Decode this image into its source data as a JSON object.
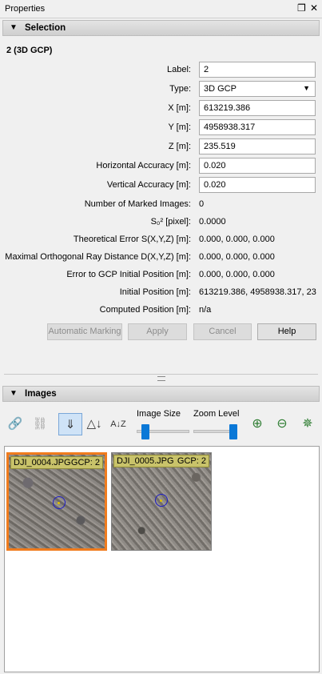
{
  "window": {
    "title": "Properties"
  },
  "selection": {
    "header": "Selection",
    "object_title": "2 (3D GCP)",
    "fields": {
      "label": {
        "label": "Label:",
        "value": "2"
      },
      "type": {
        "label": "Type:",
        "value": "3D GCP"
      },
      "x": {
        "label": "X [m]:",
        "value": "613219.386"
      },
      "y": {
        "label": "Y [m]:",
        "value": "4958938.317"
      },
      "z": {
        "label": "Z [m]:",
        "value": "235.519"
      },
      "h_acc": {
        "label": "Horizontal Accuracy [m]:",
        "value": "0.020"
      },
      "v_acc": {
        "label": "Vertical Accuracy [m]:",
        "value": "0.020"
      }
    },
    "readouts": {
      "marked": {
        "label": "Number of Marked Images:",
        "value": "0"
      },
      "s0": {
        "label": "S₀² [pixel]:",
        "value": "0.0000"
      },
      "theo": {
        "label": "Theoretical Error S(X,Y,Z) [m]:",
        "value": "0.000, 0.000, 0.000"
      },
      "maxray": {
        "label": "Maximal Orthogonal Ray Distance D(X,Y,Z) [m]:",
        "value": "0.000, 0.000, 0.000"
      },
      "err_init": {
        "label": "Error to GCP Initial Position [m]:",
        "value": "0.000, 0.000, 0.000"
      },
      "init_pos": {
        "label": "Initial Position [m]:",
        "value": "613219.386, 4958938.317, 23"
      },
      "comp_pos": {
        "label": "Computed Position [m]:",
        "value": "n/a"
      }
    },
    "buttons": {
      "auto": "Automatic Marking",
      "apply": "Apply",
      "cancel": "Cancel",
      "help": "Help"
    }
  },
  "images": {
    "header": "Images",
    "image_size_label": "Image Size",
    "zoom_level_label": "Zoom Level",
    "image_size_level": 0.1,
    "zoom_level_level": 1.0,
    "thumbnails": [
      {
        "name": "DJI_0004.JPG",
        "gcp": "GCP: 2",
        "selected": true
      },
      {
        "name": "DJI_0005.JPG",
        "gcp": "GCP: 2",
        "selected": false
      }
    ]
  },
  "colors": {
    "selected_border": "#f07c1e",
    "caption_bg": "#c9c36a",
    "marker": "#1c1cc8",
    "slider": "#0a78d7"
  }
}
